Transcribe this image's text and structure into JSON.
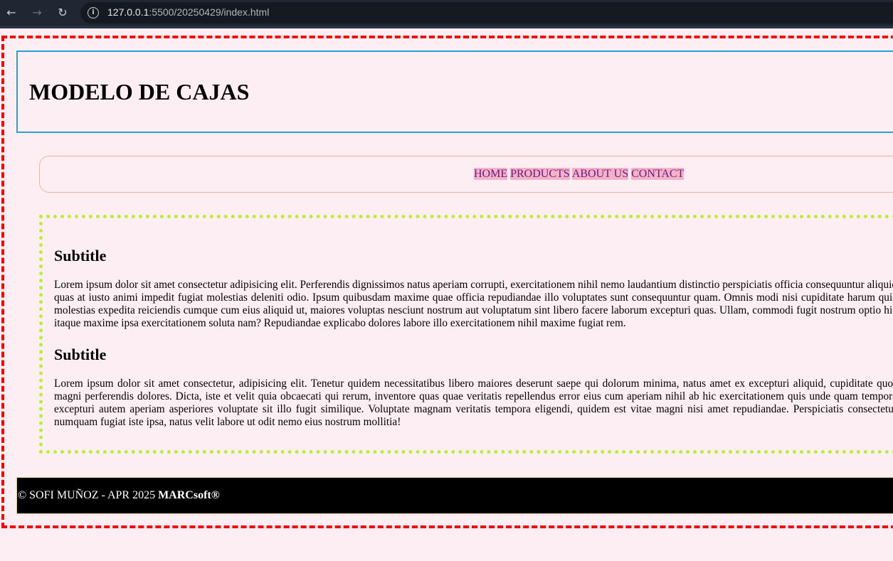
{
  "browser": {
    "back_icon": "arrow-left",
    "forward_icon": "arrow-right",
    "reload_icon": "reload",
    "url_host": "127.0.0.1",
    "url_rest": ":5500/20250429/index.html"
  },
  "header": {
    "title": "MODELO DE CAJAS"
  },
  "nav": {
    "items": [
      "HOME",
      "PRODUCTS",
      "ABOUT US",
      "CONTACT"
    ]
  },
  "main": {
    "sections": [
      {
        "title": "Subtitle",
        "text": "Lorem ipsum dolor sit amet consectetur adipisicing elit. Perferendis dignissimos natus aperiam corrupti, exercitationem nihil nemo laudantium distinctio perspiciatis officia consequuntur aliquid quas at iusto animi impedit fugiat molestias deleniti odio. Ipsum quibusdam maxime quae officia repudiandae illo voluptates sunt consequuntur quam. Omnis modi nisi cupiditate harum quia molestias expedita reiciendis cumque cum eius aliquid ut, maiores voluptas nesciunt nostrum aut voluptatum sint libero facere laborum excepturi quas. Ullam, commodi fugit nostrum optio hic itaque maxime ipsa exercitationem soluta nam? Repudiandae explicabo dolores labore illo exercitationem nihil maxime fugiat rem."
      },
      {
        "title": "Subtitle",
        "text": "Lorem ipsum dolor sit amet consectetur, adipisicing elit. Tenetur quidem necessitatibus libero maiores deserunt saepe qui dolorum minima, natus amet ex excepturi aliquid, cupiditate quos magni perferendis dolores. Dicta, iste et velit quia obcaecati qui rerum, inventore quas quae veritatis repellendus error eius cum aperiam nihil ab hic exercitationem quis unde quam tempora excepturi autem aperiam asperiores voluptate sit illo fugit similique. Voluptate magnam veritatis tempora eligendi, quidem est vitae magni nisi amet repudiandae. Perspiciatis consectetur numquam fugiat iste ipsa, natus velit labore ut odit nemo eius nostrum mollitia!"
      }
    ]
  },
  "footer": {
    "text_plain": "© SOFI MUÑOZ - APR 2025 ",
    "brand": "MARCsoft®"
  },
  "colors": {
    "page_background": "#fdeef3",
    "frame_border": "#ff0000",
    "header_border": "#2a9fd6",
    "nav_border": "#e8b79a",
    "nav_link_bg": "#f4b2c7",
    "nav_link_text": "#6b1a86",
    "main_border": "#b7f030",
    "footer_bg": "#000000"
  }
}
